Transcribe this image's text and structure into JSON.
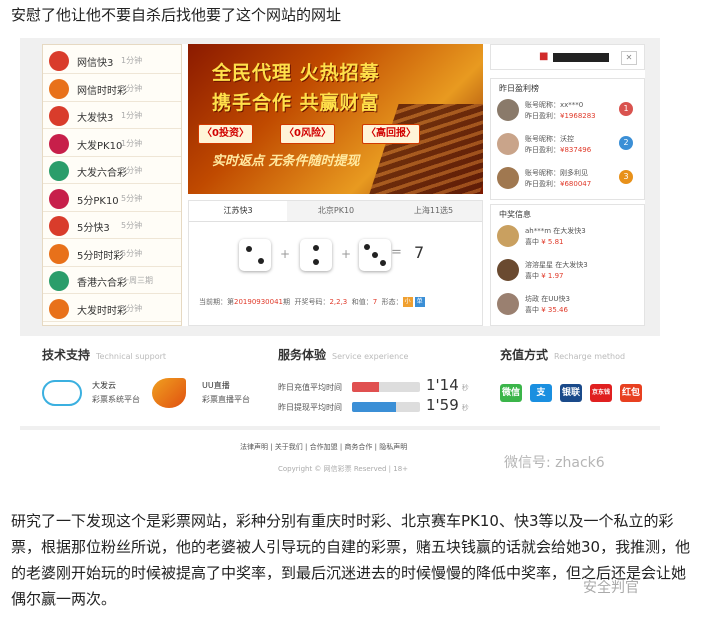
{
  "intro_text": "安慰了他让他不要自杀后找他要了这个网站的网址",
  "colors": {
    "accent_red": "#e03a2a",
    "gold": "#ffe04a",
    "blue": "#3b8fd6"
  },
  "lottery_list": [
    {
      "name": "网信快3",
      "freq": "1分钟",
      "icon": "lottery-logo-icon",
      "color": "#d93c2b"
    },
    {
      "name": "网信时时彩",
      "freq": "1分钟",
      "icon": "lottery-logo-icon",
      "color": "#e8711a"
    },
    {
      "name": "大发快3",
      "freq": "1分钟",
      "icon": "lottery-logo-icon",
      "color": "#d93c2b"
    },
    {
      "name": "大发PK10",
      "freq": "1分钟",
      "icon": "pk10-logo-icon",
      "color": "#c71f4a"
    },
    {
      "name": "大发六合彩",
      "freq": "1分钟",
      "icon": "lottery-logo-icon",
      "color": "#2a9d6a"
    },
    {
      "name": "5分PK10",
      "freq": "5分钟",
      "icon": "pk10-logo-icon",
      "color": "#c71f4a"
    },
    {
      "name": "5分快3",
      "freq": "5分钟",
      "icon": "lottery-logo-icon",
      "color": "#d93c2b"
    },
    {
      "name": "5分时时彩",
      "freq": "5分钟",
      "icon": "lottery-logo-icon",
      "color": "#e8711a"
    },
    {
      "name": "香港六合彩",
      "freq": "一周三期",
      "icon": "lottery-logo-icon",
      "color": "#2a9d6a"
    },
    {
      "name": "大发时时彩",
      "freq": "1分钟",
      "icon": "lottery-logo-icon",
      "color": "#e8711a"
    }
  ],
  "banner": {
    "line1": "全民代理 火热招募",
    "line2": "携手合作 共赢财富",
    "tags": [
      "〈0投资〉",
      "〈0风险〉",
      "〈高回报〉"
    ],
    "line3": "实时返点 无条件随时提现"
  },
  "game_tabs": [
    "江苏快3",
    "北京PK10",
    "上海11选5"
  ],
  "dice_result": {
    "values": [
      2,
      2,
      3
    ],
    "plus": "+",
    "equals": "=",
    "sum": "7"
  },
  "draw_info": {
    "prefix": "当前期：第",
    "issue": "20190930041",
    "issue_suffix": "期",
    "code_label": "开奖号码：",
    "code": "2,2,3",
    "sum_label": "和值：",
    "sum": "7",
    "shape_label": "形态：",
    "shape_small": "小",
    "shape_single": "单"
  },
  "user": {
    "icon": "user-icon",
    "button_icon": "close-icon",
    "button": "✕"
  },
  "ranking": {
    "title": "昨日盈利榜",
    "items": [
      {
        "name_label": "账号昵称：",
        "name": "xx***0",
        "amount_label": "昨日盈利：",
        "amount": "¥1968283",
        "medal": "1",
        "medal_color": "#d9534f",
        "avatar_color": "#8a7a6a"
      },
      {
        "name_label": "账号昵称：",
        "name": "沃控",
        "amount_label": "昨日盈利：",
        "amount": "¥837496",
        "medal": "2",
        "medal_color": "#3b8fd6",
        "avatar_color": "#c9a48a"
      },
      {
        "name_label": "账号昵称：",
        "name": "刚多利见",
        "amount_label": "昨日盈利：",
        "amount": "¥680047",
        "medal": "3",
        "medal_color": "#e8911a",
        "avatar_color": "#a07850"
      }
    ]
  },
  "winners": {
    "title": "中奖信息",
    "items": [
      {
        "name": "ah***m",
        "where": "在大发快3",
        "label": "喜中",
        "amount": "¥ 5.81",
        "avatar_color": "#c9a060"
      },
      {
        "name": "溶溶星星",
        "where": "在大发快3",
        "label": "喜中",
        "amount": "¥ 1.97",
        "avatar_color": "#6a4a30"
      },
      {
        "name": "坊政",
        "where": "在UU快3",
        "label": "喜中",
        "amount": "¥ 35.46",
        "avatar_color": "#9a8070"
      }
    ]
  },
  "support": {
    "title": "技术支持",
    "subtitle": "Technical support",
    "items": [
      {
        "name": "大发云",
        "desc": "彩票系统平台",
        "icon": "cloud-icon"
      },
      {
        "name": "UU直播",
        "desc": "彩票直播平台",
        "icon": "fox-icon"
      }
    ]
  },
  "service": {
    "title": "服务体验",
    "subtitle": "Service experience",
    "items": [
      {
        "label": "昨日充值平均时间",
        "fill": 0.4,
        "color": "#e05050",
        "value": "1'14",
        "unit": "秒"
      },
      {
        "label": "昨日提现平均时间",
        "fill": 0.65,
        "color": "#3b8fd6",
        "value": "1'59",
        "unit": "秒"
      }
    ]
  },
  "recharge": {
    "title": "充值方式",
    "subtitle": "Recharge method",
    "methods": [
      {
        "name": "微信",
        "icon": "wechat-icon",
        "color": "#3bb54a"
      },
      {
        "name": "支",
        "icon": "alipay-icon",
        "color": "#1a8fe0"
      },
      {
        "name": "银联",
        "icon": "unionpay-icon",
        "color": "#1a4a8a"
      },
      {
        "name": "京东钱包",
        "icon": "jd-wallet-icon",
        "color": "#e02020"
      },
      {
        "name": "红包",
        "icon": "red-packet-icon",
        "color": "#e84020"
      }
    ]
  },
  "footer": {
    "links": [
      "法律声明",
      "关于我们",
      "合作加盟",
      "商务合作",
      "隐私声明"
    ],
    "copyright": "Copyright © 网信彩票 Reserved | 18+",
    "watermark": "微信号: zhack6"
  },
  "body_text": "研究了一下发现这个是彩票网站，彩种分别有重庆时时彩、北京赛车PK10、快3等以及一个私立的彩票，根据那位粉丝所说，他的老婆被人引导玩的自建的彩票，赌五块钱赢的话就会给她30，我推测，他的老婆刚开始玩的时候被提高了中奖率，到最后沉迷进去的时候慢慢的降低中奖率，但之后还是会让她偶尔赢一两次。",
  "bottom_watermark": "安全判官"
}
